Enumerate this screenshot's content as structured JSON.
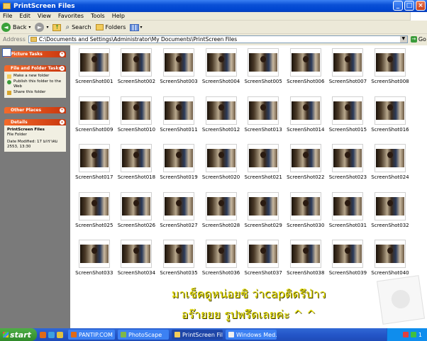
{
  "window": {
    "title": "PrintScreen Files"
  },
  "menu": [
    "File",
    "Edit",
    "View",
    "Favorites",
    "Tools",
    "Help"
  ],
  "toolbar": {
    "back": "Back",
    "search": "Search",
    "folders": "Folders"
  },
  "address": {
    "label": "Address",
    "path": "C:\\Documents and Settings\\Administrator\\My Documents\\PrintScreen Files",
    "go": "Go"
  },
  "sidebar": {
    "picture_tasks": {
      "title": "Picture Tasks"
    },
    "file_folder_tasks": {
      "title": "File and Folder Tasks",
      "items": [
        "Make a new folder",
        "Publish this folder to the Web",
        "Share this folder"
      ]
    },
    "other_places": {
      "title": "Other Places"
    },
    "details": {
      "title": "Details",
      "name": "PrintScreen Files",
      "type": "File Folder",
      "modified": "Date Modified: 17 มกราคม 2553, 13:30"
    }
  },
  "files": [
    "ScreenShot001",
    "ScreenShot002",
    "ScreenShot003",
    "ScreenShot004",
    "ScreenShot005",
    "ScreenShot006",
    "ScreenShot007",
    "ScreenShot008",
    "ScreenShot009",
    "ScreenShot010",
    "ScreenShot011",
    "ScreenShot012",
    "ScreenShot013",
    "ScreenShot014",
    "ScreenShot015",
    "ScreenShot016",
    "ScreenShot017",
    "ScreenShot018",
    "ScreenShot019",
    "ScreenShot020",
    "ScreenShot021",
    "ScreenShot022",
    "ScreenShot023",
    "ScreenShot024",
    "ScreenShot025",
    "ScreenShot026",
    "ScreenShot027",
    "ScreenShot028",
    "ScreenShot029",
    "ScreenShot030",
    "ScreenShot031",
    "ScreenShot032",
    "ScreenShot033",
    "ScreenShot034",
    "ScreenShot035",
    "ScreenShot036",
    "ScreenShot037",
    "ScreenShot038",
    "ScreenShot039",
    "ScreenShot040"
  ],
  "overlay": {
    "line1": "มาเช็คดูหน่อยซิ ว่าcapติดรึป่าว",
    "line2": "อร๊ายยย รูปพรึดเลยค่ะ ^ ^",
    "color": "#e8e000"
  },
  "taskbar": {
    "start": "start",
    "tasks": [
      "PANTIP.COM ...",
      "PhotoScape",
      "PrintScreen Files",
      "Windows Med..."
    ],
    "active_task": "PrintScreen Files",
    "clock": "1"
  }
}
